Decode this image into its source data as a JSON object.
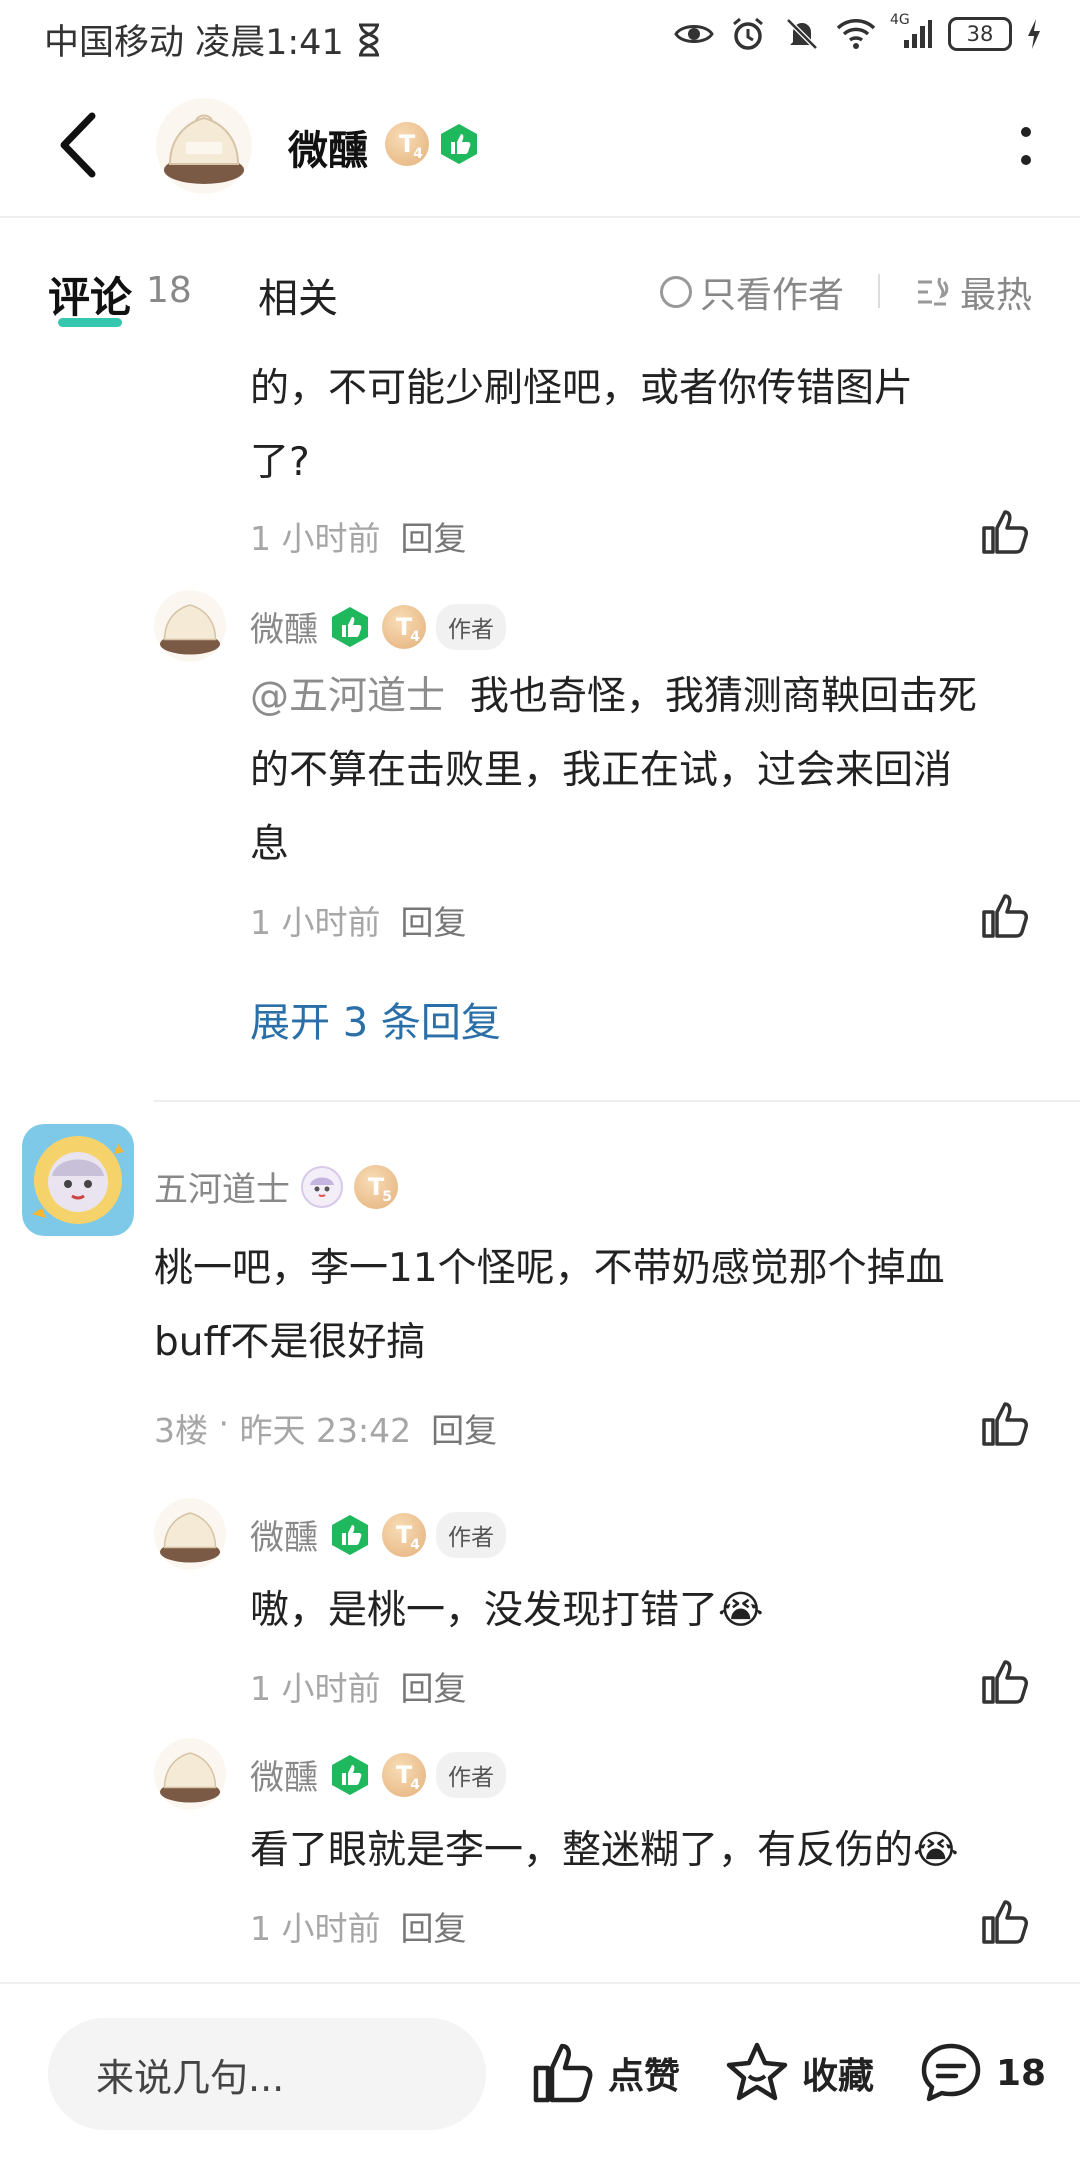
{
  "status_bar": {
    "carrier_time": "中国移动 凌晨1:41",
    "network": "4G",
    "battery": "38"
  },
  "header": {
    "username": "微醺",
    "level_badge": "T",
    "level_sub": "4"
  },
  "tabs": {
    "comments_label": "评论",
    "comments_count": "18",
    "related_label": "相关",
    "only_author_label": "只看作者",
    "sort_label": "最热"
  },
  "comments": {
    "top_partial": {
      "text_line1": "的，不可能少刷怪吧，或者你传错图片",
      "text_line2": "了?",
      "time": "1 小时前",
      "reply": "回复"
    },
    "reply_a": {
      "name": "微醺",
      "badge_t": "T",
      "badge_t_sub": "4",
      "author_tag": "作者",
      "mention": "@五河道士",
      "text_line1": "我也奇怪，我猜测商鞅回击死",
      "text_line2": "的不算在击败里，我正在试，过会来回消",
      "text_line3": "息",
      "time": "1 小时前",
      "reply": "回复"
    },
    "expand_label": "展开 3 条回复",
    "floor3": {
      "name": "五河道士",
      "badge_t": "T",
      "badge_t_sub": "5",
      "text_line1": "桃一吧，李一11个怪呢，不带奶感觉那个掉血",
      "text_line2": "buff不是很好搞",
      "floor": "3楼",
      "time": "昨天 23:42",
      "reply": "回复"
    },
    "reply_b": {
      "name": "微醺",
      "badge_t": "T",
      "badge_t_sub": "4",
      "author_tag": "作者",
      "text": "嗷，是桃一，没发现打错了",
      "emoji": "😭",
      "time": "1 小时前",
      "reply": "回复"
    },
    "reply_c": {
      "name": "微醺",
      "badge_t": "T",
      "badge_t_sub": "4",
      "author_tag": "作者",
      "text": "看了眼就是李一，整迷糊了，有反伤的",
      "emoji": "😭",
      "time": "1 小时前",
      "reply": "回复"
    }
  },
  "bottom_bar": {
    "input_placeholder": "来说几句...",
    "like_label": "点赞",
    "favorite_label": "收藏",
    "comment_count": "18"
  },
  "colors": {
    "accent_teal": "#35c7b0",
    "link_blue": "#2a6fa8",
    "badge_green": "#1fb85c",
    "badge_gold": "#e4b07a"
  }
}
